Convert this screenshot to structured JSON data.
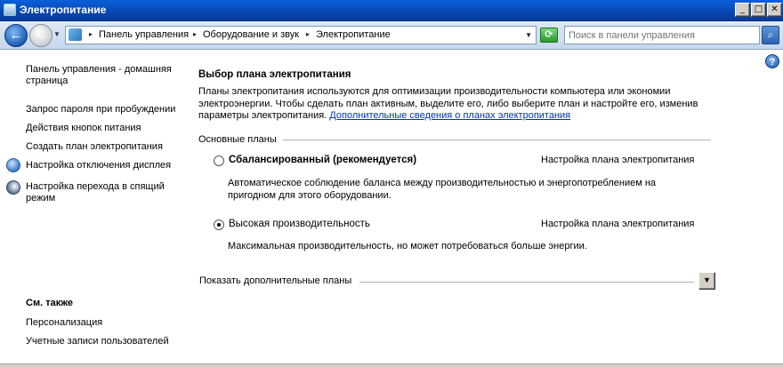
{
  "window": {
    "title": "Электропитание",
    "minimize": "_",
    "maximize": "□",
    "close": "✕"
  },
  "address": {
    "breadcrumbs": [
      "Панель управления",
      "Оборудование и звук",
      "Электропитание"
    ],
    "search_placeholder": "Поиск в панели управления"
  },
  "icons": {
    "back": "back-arrow-icon",
    "forward": "forward-arrow-icon",
    "refresh": "refresh-icon",
    "search": "search-icon",
    "help": "help-icon"
  },
  "sidebar": {
    "home_line1": "Панель управления - домашняя",
    "home_line2": "страница",
    "items": [
      "Запрос пароля при пробуждении",
      "Действия кнопок питания",
      "Создать план электропитания",
      "Настройка отключения дисплея"
    ],
    "sleep_line1": "Настройка перехода в спящий",
    "sleep_line2": "режим",
    "see_also_title": "См. также",
    "see_also": [
      "Персонализация",
      "Учетные записи пользователей"
    ]
  },
  "main": {
    "heading": "Выбор плана электропитания",
    "desc_line1": "Планы электропитания используются для оптимизации производительности компьютера или экономии",
    "desc_line2": "электроэнергии. Чтобы сделать план активным, выделите его, либо выберите план и настройте его, изменив",
    "desc_line3": "параметры электропитания.",
    "desc_link": "Дополнительные сведения о планах электропитания",
    "group_label": "Основные планы",
    "plans": [
      {
        "name": "Сбалансированный (рекомендуется)",
        "link": "Настройка плана электропитания",
        "desc_line1": "Автоматическое соблюдение баланса между производительностью и энергопотреблением на",
        "desc_line2": "пригодном для этого оборудовании.",
        "selected": false
      },
      {
        "name": "Высокая производительность",
        "link": "Настройка плана электропитания",
        "desc_line1": "Максимальная производительность, но может потребоваться больше энергии.",
        "selected": true
      }
    ],
    "show_more": "Показать дополнительные планы"
  }
}
